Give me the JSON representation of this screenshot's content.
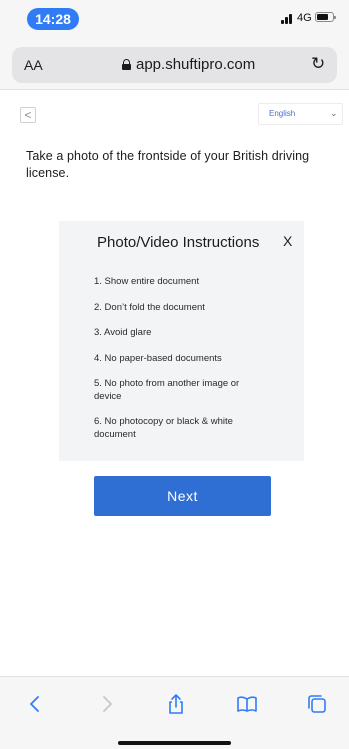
{
  "status_bar": {
    "time": "14:28",
    "network": "4G"
  },
  "browser": {
    "text_size_label": "AA",
    "url": "app.shuftipro.com"
  },
  "page": {
    "back_glyph": "<",
    "language": "English",
    "instruction": "Take a photo of the frontside of your British driving license.",
    "panel": {
      "title": "Photo/Video Instructions",
      "close": "X",
      "items": [
        "1. Show entire document",
        "2. Don’t fold the document",
        "3. Avoid glare",
        "4. No paper-based documents",
        "5. No photo from another image or device",
        "6. No photocopy or black & white document"
      ]
    },
    "next_label": "Next"
  },
  "colors": {
    "accent": "#2f6fd3",
    "time_pill": "#2f7cf6",
    "panel_bg": "#f3f4f6"
  },
  "icons": {
    "lock": "lock-icon",
    "reload": "reload-icon",
    "back": "back-arrow-icon",
    "forward": "forward-arrow-icon",
    "share": "share-icon",
    "bookmarks": "book-icon",
    "tabs": "tabs-icon"
  }
}
